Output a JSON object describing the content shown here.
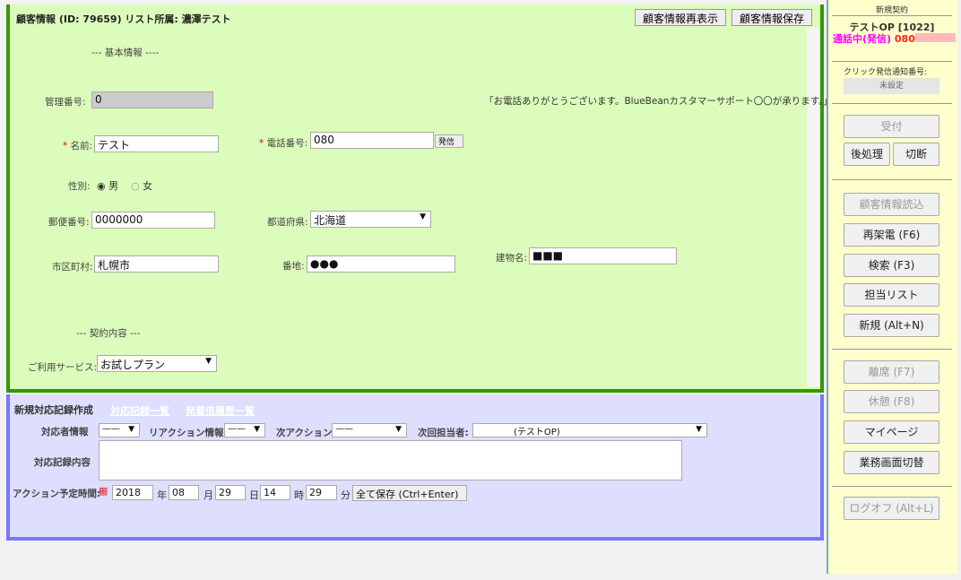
{
  "main": {
    "tab_title": "顧客情報 (ID: 79659) リスト所属: 濃澤テスト",
    "reload_button": "顧客情報再表示",
    "save_button": "顧客情報保存",
    "section_basic": "--- 基本情報 ----",
    "greeting": "「お電話ありがとうございます。BlueBeanカスタマーサポート〇〇が承ります。」",
    "fields": {
      "manage_no_label": "管理番号:",
      "manage_no": "0",
      "name_label": "名前:",
      "name": "テスト",
      "phone_label": "電話番号:",
      "phone": "080",
      "dial_button": "発信",
      "gender_label": "性別:",
      "gender_male": "男",
      "gender_female": "女",
      "gender_selected": "男",
      "zip_label": "郵便番号:",
      "zip": "0000000",
      "pref_label": "都道府県:",
      "pref": "北海道",
      "city_label": "市区町村:",
      "city": "札幌市",
      "addr_label": "番地:",
      "addr": "●●●",
      "bldg_label": "建物名:",
      "bldg": "■■■"
    },
    "section_contract": "--- 契約内容 ---",
    "service_label": "ご利用サービス:",
    "service": "お試しプラン"
  },
  "lower": {
    "tabs": [
      "新規対応記録作成",
      "対応記録一覧",
      "発着信履歴一覧"
    ],
    "responder_label": "対応者情報",
    "responder": "——",
    "reaction_label": "リアクション情報:",
    "reaction": "——",
    "next_action_label": "次アクション:",
    "next_action": "——",
    "next_owner_label": "次回担当者:",
    "next_owner": "(テストOP)",
    "record_label": "対応記録内容",
    "record": "",
    "schedule_label": "アクション予定時間:",
    "year": "2018",
    "year_unit": "年",
    "month": "08",
    "month_unit": "月",
    "day": "29",
    "day_unit": "日",
    "hour": "14",
    "hour_unit": "時",
    "minute": "29",
    "minute_unit": "分",
    "save_all_button": "全て保存 (Ctrl+Enter)"
  },
  "side": {
    "title": "新規契約",
    "operator": "テストOP [1022]",
    "status": "通話中(発信)",
    "status_number": "080",
    "status_color": "#ff00ff",
    "notify_label": "クリック発信通知番号:",
    "notify_value": "未設定",
    "buttons": {
      "accept": "受付",
      "after": "後処理",
      "hangup": "切断",
      "load": "顧客情報読込",
      "redial": "再架電 (F6)",
      "search": "検索 (F3)",
      "list": "担当リスト",
      "new": "新規 (Alt+N)",
      "away": "離席 (F7)",
      "rest": "休憩 (F8)",
      "mypage": "マイページ",
      "switch": "業務画面切替",
      "logoff": "ログオフ (Alt+L)"
    }
  }
}
